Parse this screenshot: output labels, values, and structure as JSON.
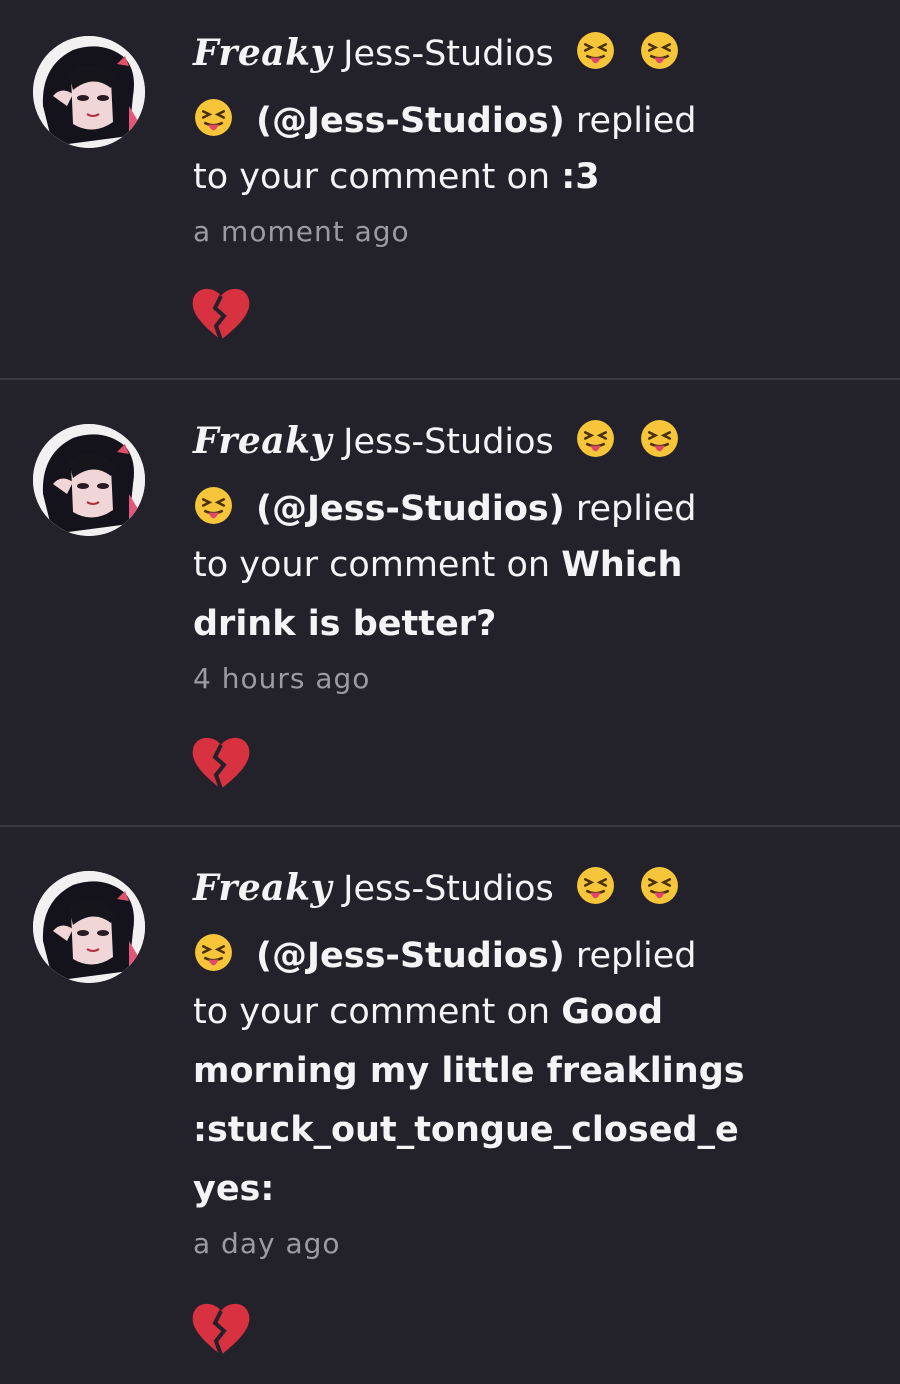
{
  "notifications": [
    {
      "display_name": "Freaky",
      "name_rest": "Jess-Studios",
      "handle": "(@Jess-Studios)",
      "verb": "replied",
      "prefix": "to your comment on",
      "target_lines": [
        ":3"
      ],
      "time": "a moment ago",
      "reaction_icon": "broken-heart-icon"
    },
    {
      "display_name": "Freaky",
      "name_rest": "Jess-Studios",
      "handle": "(@Jess-Studios)",
      "verb": "replied",
      "prefix": "to your comment on",
      "target_lines": [
        "Which",
        "drink is better?"
      ],
      "time": "4 hours ago",
      "reaction_icon": "broken-heart-icon"
    },
    {
      "display_name": "Freaky",
      "name_rest": "Jess-Studios",
      "handle": "(@Jess-Studios)",
      "verb": "replied",
      "prefix": "to your comment on",
      "target_lines": [
        "Good",
        "morning my little freaklings",
        ":stuck_out_tongue_closed_e",
        "yes:"
      ],
      "time": "a day ago",
      "reaction_icon": "broken-heart-icon"
    }
  ],
  "colors": {
    "background": "#23222b",
    "divider": "#3b3a44",
    "text": "#f4f4f6",
    "timestamp": "#9b9aa5",
    "broken_heart": "#d8313f"
  }
}
